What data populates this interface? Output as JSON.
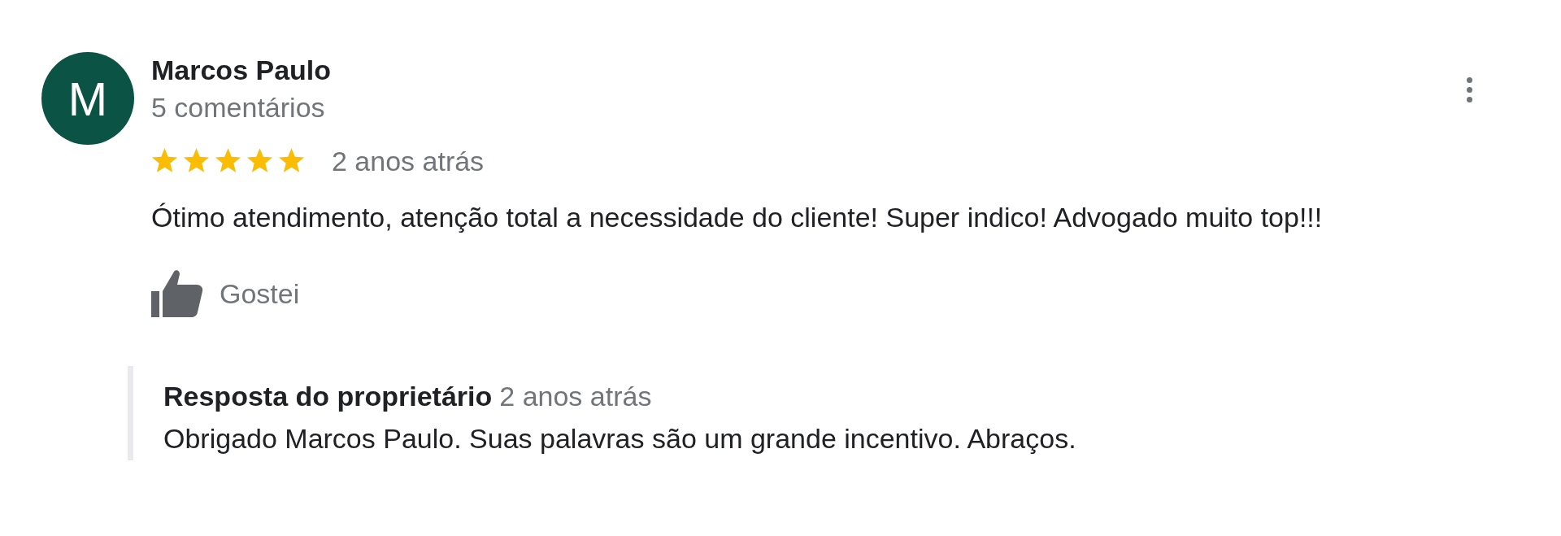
{
  "review": {
    "avatar_letter": "M",
    "author": "Marcos Paulo",
    "meta": "5 comentários",
    "stars": 5,
    "time": "2 anos atrás",
    "text": "Ótimo atendimento, atenção total a necessidade do cliente! Super indico! Advogado muito top!!!",
    "like_label": "Gostei",
    "owner_reply": {
      "title": "Resposta do proprietário",
      "time": "2 anos atrás",
      "text": "Obrigado Marcos Paulo. Suas palavras são um grande incentivo. Abraços."
    }
  }
}
